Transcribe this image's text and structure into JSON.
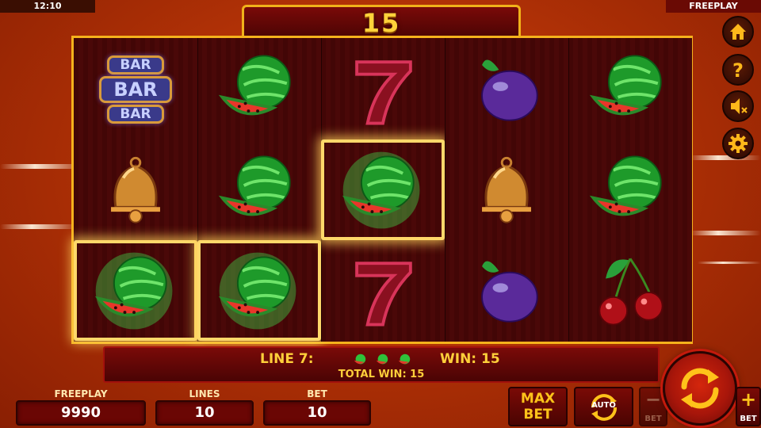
{
  "status_bar": {
    "time": "12:10",
    "mode": "FREEPLAY"
  },
  "win_banner": {
    "amount": "15"
  },
  "reels": {
    "columns": [
      [
        "bar-triple",
        "bell",
        "watermelon"
      ],
      [
        "watermelon",
        "watermelon",
        "watermelon"
      ],
      [
        "seven",
        "watermelon",
        "seven"
      ],
      [
        "plum",
        "bell",
        "plum"
      ],
      [
        "watermelon",
        "watermelon",
        "cherries"
      ]
    ],
    "bar_text": "BAR",
    "highlighted_cells": [
      [
        0,
        2
      ],
      [
        1,
        2
      ],
      [
        2,
        1
      ]
    ]
  },
  "win_info": {
    "line_label": "LINE 7:",
    "line_symbols": [
      "watermelon",
      "watermelon",
      "watermelon"
    ],
    "win_label": "WIN: 15",
    "total_label": "TOTAL WIN: 15"
  },
  "stats": {
    "credit_label": "FREEPLAY",
    "credit_value": "9990",
    "lines_label": "LINES",
    "lines_value": "10",
    "bet_label": "BET",
    "bet_value": "10"
  },
  "buttons": {
    "max_bet_line1": "MAX",
    "max_bet_line2": "BET",
    "auto_label": "AUTO",
    "bet_minus_sign": "−",
    "bet_minus_label": "BET",
    "bet_plus_sign": "+",
    "bet_plus_label": "BET"
  },
  "side_menu": [
    "home-icon",
    "help-icon",
    "sound-off-icon",
    "settings-icon"
  ],
  "colors": {
    "accent_gold": "#f5b21c",
    "highlight": "#ffd86a",
    "panel_red": "#7a0a08"
  }
}
